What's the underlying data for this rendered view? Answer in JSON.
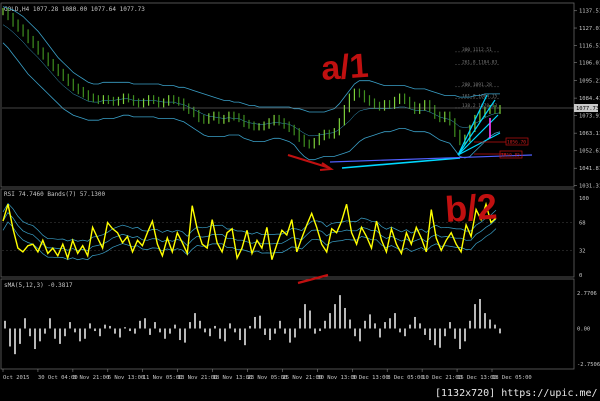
{
  "watermark": "[1132x720] https://upic.me/",
  "colors": {
    "bg": "#000000",
    "price_bull": "#7cd03a",
    "price_bear": "#3f8f1f",
    "bands": "#3aa0c8",
    "rsi": "#ffff00",
    "rsi_bands": "#3aa0c8",
    "macd": "#b8b8b8",
    "annotation": "#c01010",
    "cyan_line": "#00d8ff",
    "blue_line": "#5060ff",
    "magenta": "#ff40ff"
  },
  "chart_data": [
    {
      "type": "line",
      "panel": "price",
      "header": "GOLD,H4  1077.28 1080.00 1077.64 1077.73",
      "ylim": [
        1031,
        1141
      ],
      "ytick_labels": [
        "1137.51",
        "1127.01",
        "1116.51",
        "1106.01",
        "1095.21",
        "1084.41",
        "1073.91",
        "1063.11",
        "1052.61",
        "1041.81",
        "1031.31"
      ],
      "ytick_values": [
        1137.51,
        1127.01,
        1116.51,
        1106.01,
        1095.21,
        1084.41,
        1073.91,
        1063.11,
        1052.61,
        1041.81,
        1031.31
      ],
      "current_price_label": "1077.73",
      "current_price": 1077.73,
      "fib_levels": [
        {
          "label": "300  1112.51",
          "value": 1112.51
        },
        {
          "label": "261.8  1104.83",
          "value": 1104.83
        },
        {
          "label": "200  1091.28",
          "value": 1091.28
        },
        {
          "label": "161.8  1084.15",
          "value": 1084.15
        },
        {
          "label": "138.2  1078.43",
          "value": 1078.43
        }
      ],
      "price_tags": [
        {
          "label": "1056.70",
          "value": 1056.7
        },
        {
          "label": "1050.85",
          "value": 1050.85
        }
      ],
      "close": [
        1137,
        1134,
        1130,
        1127,
        1124,
        1120,
        1117,
        1113,
        1110,
        1106,
        1103,
        1100,
        1097,
        1094,
        1091,
        1089,
        1087,
        1085,
        1084,
        1083,
        1084,
        1083,
        1082,
        1083,
        1085,
        1084,
        1082,
        1081,
        1082,
        1084,
        1083,
        1081,
        1082,
        1084,
        1083,
        1082,
        1079,
        1077,
        1075,
        1072,
        1071,
        1073,
        1074,
        1071,
        1072,
        1074,
        1073,
        1072,
        1069,
        1068,
        1067,
        1067,
        1068,
        1070,
        1072,
        1070,
        1068,
        1066,
        1064,
        1060,
        1057,
        1056,
        1058,
        1061,
        1063,
        1062,
        1064,
        1070,
        1078,
        1085,
        1088,
        1087,
        1084,
        1082,
        1080,
        1079,
        1081,
        1080,
        1083,
        1085,
        1083,
        1080,
        1077,
        1079,
        1081,
        1078,
        1074,
        1072,
        1074,
        1070,
        1063,
        1058,
        1060,
        1066,
        1072,
        1075,
        1077,
        1078,
        1077,
        1078
      ],
      "upper_band": [
        1140,
        1139,
        1138,
        1136,
        1134,
        1131,
        1128,
        1125,
        1121,
        1117,
        1113,
        1109,
        1106,
        1103,
        1100,
        1098,
        1096,
        1094,
        1093,
        1093,
        1094,
        1094,
        1094,
        1094,
        1094,
        1094,
        1093,
        1093,
        1093,
        1093,
        1093,
        1093,
        1092,
        1092,
        1092,
        1091,
        1091,
        1090,
        1089,
        1088,
        1087,
        1086,
        1085,
        1084,
        1083,
        1083,
        1082,
        1082,
        1081,
        1080,
        1080,
        1079,
        1079,
        1079,
        1079,
        1079,
        1079,
        1079,
        1078,
        1078,
        1077,
        1076,
        1076,
        1076,
        1076,
        1077,
        1078,
        1081,
        1085,
        1089,
        1093,
        1095,
        1095,
        1095,
        1094,
        1093,
        1092,
        1092,
        1092,
        1092,
        1092,
        1091,
        1090,
        1090,
        1090,
        1089,
        1088,
        1087,
        1086,
        1086,
        1086,
        1085,
        1085,
        1085,
        1086,
        1086,
        1087,
        1087,
        1087,
        1087
      ],
      "lower_band": [
        1118,
        1115,
        1111,
        1107,
        1103,
        1099,
        1096,
        1093,
        1090,
        1087,
        1084,
        1081,
        1078,
        1076,
        1074,
        1073,
        1072,
        1071,
        1071,
        1071,
        1072,
        1072,
        1072,
        1073,
        1074,
        1074,
        1073,
        1073,
        1073,
        1073,
        1073,
        1072,
        1072,
        1072,
        1072,
        1071,
        1070,
        1068,
        1066,
        1064,
        1062,
        1061,
        1061,
        1061,
        1061,
        1062,
        1062,
        1062,
        1060,
        1059,
        1058,
        1058,
        1058,
        1059,
        1060,
        1060,
        1059,
        1058,
        1056,
        1052,
        1049,
        1047,
        1047,
        1048,
        1049,
        1049,
        1049,
        1050,
        1051,
        1052,
        1055,
        1058,
        1060,
        1061,
        1062,
        1063,
        1064,
        1064,
        1065,
        1066,
        1066,
        1065,
        1064,
        1064,
        1064,
        1063,
        1061,
        1059,
        1058,
        1057,
        1053,
        1049,
        1048,
        1049,
        1052,
        1055,
        1058,
        1061,
        1063,
        1064
      ],
      "x_tick_labels": [
        "Oct 2015",
        "30 Oct 04:00",
        "3 Nov 21:00",
        "6 Nov 13:00",
        "11 Nov 05:00",
        "13 Nov 21:00",
        "18 Nov 13:00",
        "23 Nov 05:00",
        "25 Nov 21:00",
        "30 Nov 13:00",
        "3 Dec 13:00",
        "8 Dec 05:00",
        "10 Dec 21:00",
        "15 Dec 13:00",
        "18 Dec 05:00"
      ]
    },
    {
      "type": "line",
      "panel": "rsi",
      "header": "RSI 74.7460  Bands(7) 57.1300",
      "ylim": [
        0,
        100
      ],
      "ytick_labels": [
        "100",
        "68",
        "32",
        "0"
      ],
      "ytick_values": [
        100,
        68,
        32,
        0
      ],
      "values": [
        70,
        92,
        60,
        35,
        30,
        38,
        40,
        30,
        45,
        28,
        35,
        25,
        40,
        22,
        45,
        28,
        38,
        25,
        62,
        48,
        35,
        68,
        60,
        55,
        42,
        50,
        30,
        45,
        38,
        55,
        70,
        40,
        25,
        48,
        30,
        55,
        42,
        28,
        90,
        60,
        40,
        35,
        72,
        42,
        30,
        55,
        60,
        22,
        35,
        58,
        28,
        45,
        35,
        62,
        20,
        40,
        58,
        52,
        72,
        30,
        48,
        65,
        80,
        62,
        40,
        30,
        60,
        55,
        70,
        92,
        55,
        40,
        62,
        50,
        35,
        70,
        45,
        30,
        60,
        40,
        28,
        55,
        40,
        62,
        48,
        30,
        85,
        48,
        32,
        45,
        55,
        40,
        30,
        65,
        50,
        85,
        72,
        92,
        68,
        74
      ]
    },
    {
      "type": "bar",
      "panel": "macd",
      "header": "sMA(5,12,3) -0.3817",
      "ylim": [
        -3.0,
        3.0
      ],
      "ytick_labels": [
        "2.7706",
        "0.00",
        "-2.7506"
      ],
      "ytick_values": [
        2.7706,
        0.0,
        -2.7506
      ],
      "values": [
        0.6,
        -1.4,
        -2.0,
        -1.2,
        0.8,
        -0.6,
        -1.6,
        -1.0,
        -0.4,
        0.8,
        -0.8,
        -1.2,
        -0.6,
        0.5,
        -0.3,
        -1.0,
        -0.8,
        0.4,
        -0.2,
        -0.6,
        0.3,
        0.2,
        -0.4,
        -0.7,
        0.1,
        -0.2,
        -0.4,
        0.6,
        0.8,
        -0.5,
        0.5,
        -0.3,
        -0.8,
        -0.4,
        0.3,
        -0.9,
        -1.1,
        0.5,
        1.2,
        0.6,
        -0.3,
        -0.6,
        0.2,
        -0.8,
        -1.0,
        0.4,
        -0.3,
        -0.9,
        -1.3,
        0.2,
        0.9,
        1.0,
        -0.5,
        -0.9,
        -0.4,
        0.6,
        -0.4,
        -1.1,
        -0.7,
        0.8,
        1.9,
        1.4,
        -0.4,
        -0.2,
        0.6,
        1.2,
        1.9,
        2.6,
        1.6,
        0.7,
        -0.6,
        -1.0,
        0.6,
        1.1,
        0.4,
        -0.7,
        0.5,
        0.8,
        1.2,
        -0.3,
        -0.6,
        0.3,
        0.9,
        0.4,
        -0.5,
        -0.9,
        -1.3,
        -1.5,
        -0.6,
        0.5,
        -0.8,
        -1.6,
        -1.0,
        0.6,
        1.9,
        2.3,
        1.2,
        0.7,
        0.3,
        -0.38
      ]
    }
  ],
  "annotations": {
    "wave_a": "a/1",
    "wave_b": "b/2"
  }
}
